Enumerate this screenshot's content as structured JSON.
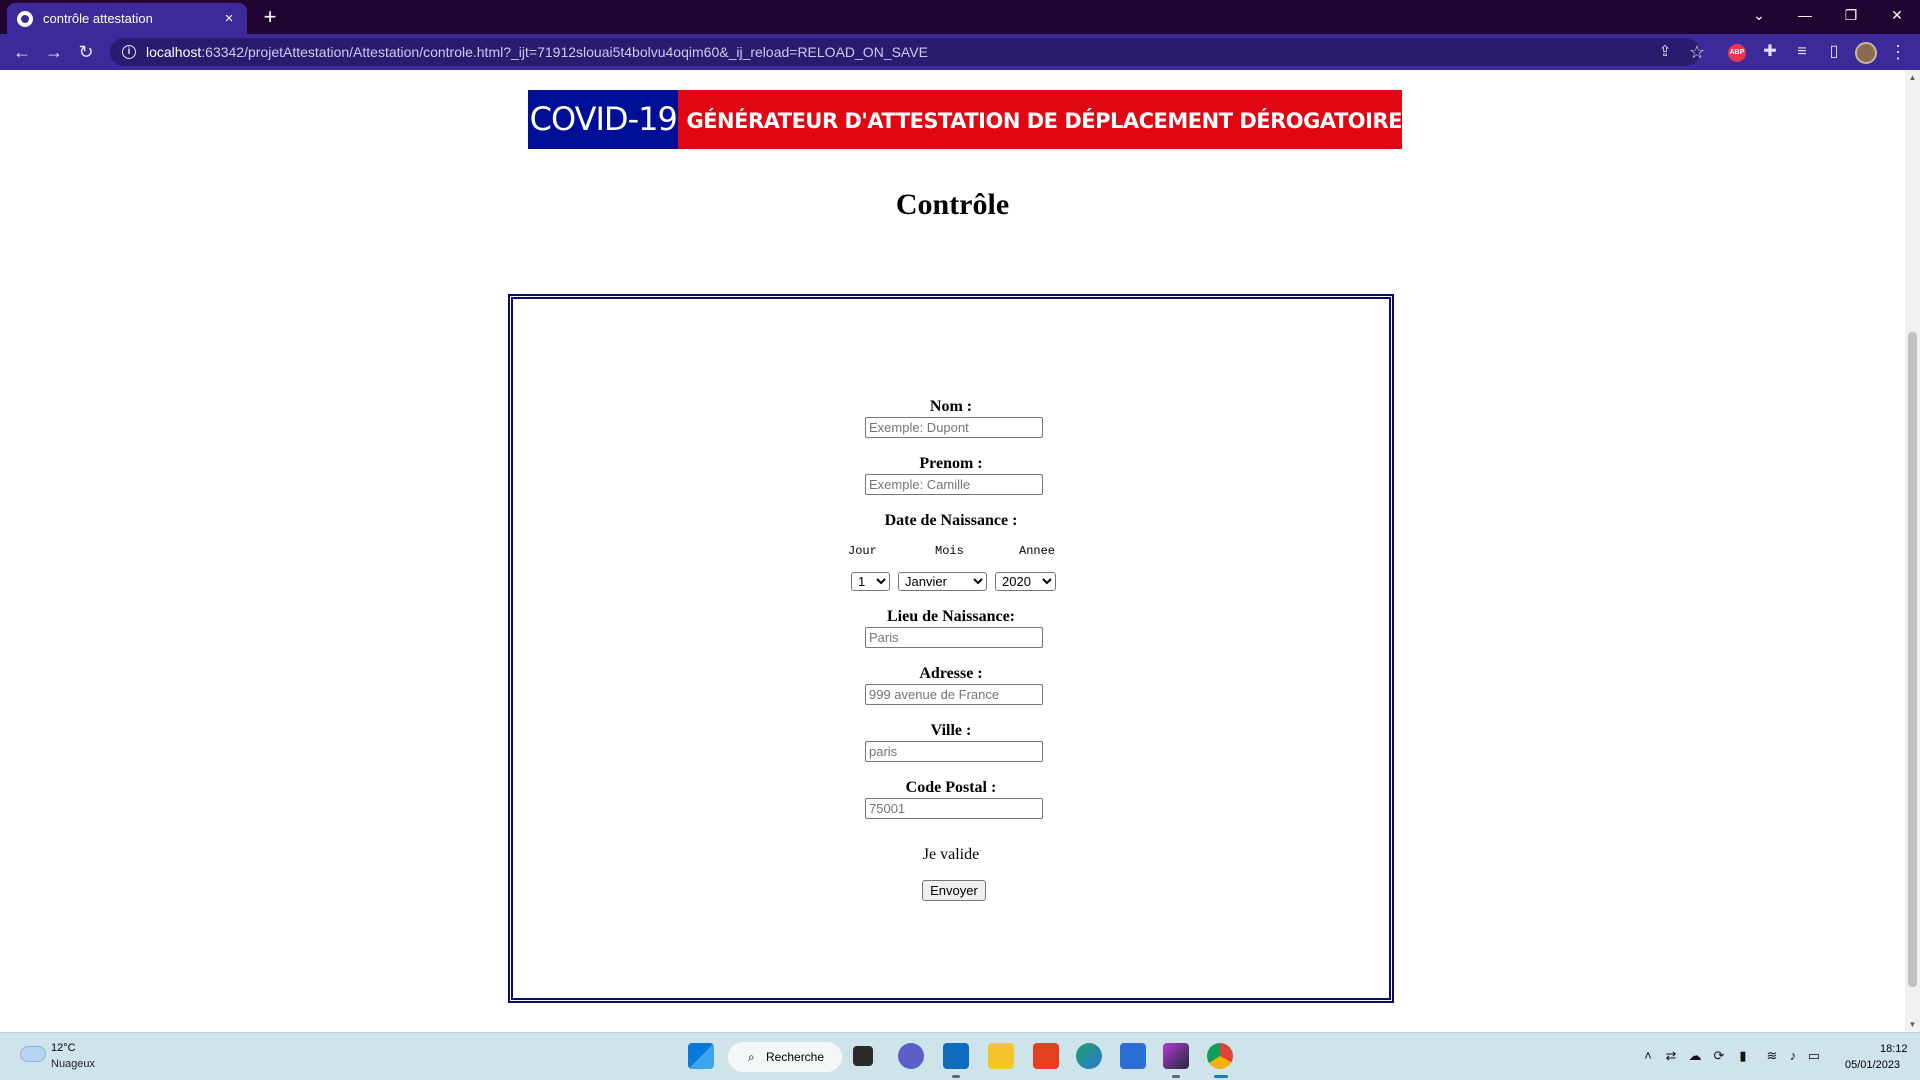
{
  "browser": {
    "tab_title": "contrôle attestation",
    "url_host": "localhost",
    "url_rest": ":63342/projetAttestation/Attestation/controle.html?_ijt=71912slouai5t4bolvu4oqim60&_ij_reload=RELOAD_ON_SAVE",
    "ext_abp_label": "ABP"
  },
  "banner": {
    "left_text": "COVID-19",
    "right_text": "GÉNÉRATEUR D'ATTESTATION DE DÉPLACEMENT DÉROGATOIRE"
  },
  "page": {
    "title": "Contrôle"
  },
  "form": {
    "nom": {
      "label": "Nom :",
      "placeholder": "Exemple: Dupont"
    },
    "prenom": {
      "label": "Prenom :",
      "placeholder": "Exemple: Camille"
    },
    "naissance": {
      "label": "Date de Naissance :",
      "jour_label": "Jour",
      "mois_label": "Mois",
      "annee_label": "Annee",
      "jour_value": "1",
      "mois_value": "Janvier",
      "annee_value": "2020"
    },
    "lieu": {
      "label": "Lieu de Naissance:",
      "placeholder": "Paris"
    },
    "adresse": {
      "label": "Adresse :",
      "placeholder": "999 avenue de France"
    },
    "ville": {
      "label": "Ville :",
      "placeholder": "paris"
    },
    "code_postal": {
      "label": "Code Postal :",
      "placeholder": "75001"
    },
    "valide_text": "Je valide",
    "submit_label": "Envoyer"
  },
  "taskbar": {
    "weather_temp": "12°C",
    "weather_cond": "Nuageux",
    "search_label": "Recherche",
    "time": "18:12",
    "date": "05/01/2023"
  },
  "colors": {
    "banner_blue": "#000f96",
    "banner_red": "#e10613",
    "form_border": "#0a0a6e",
    "chrome_dark": "#1f0330",
    "chrome_toolbar": "#3d2a9a"
  }
}
